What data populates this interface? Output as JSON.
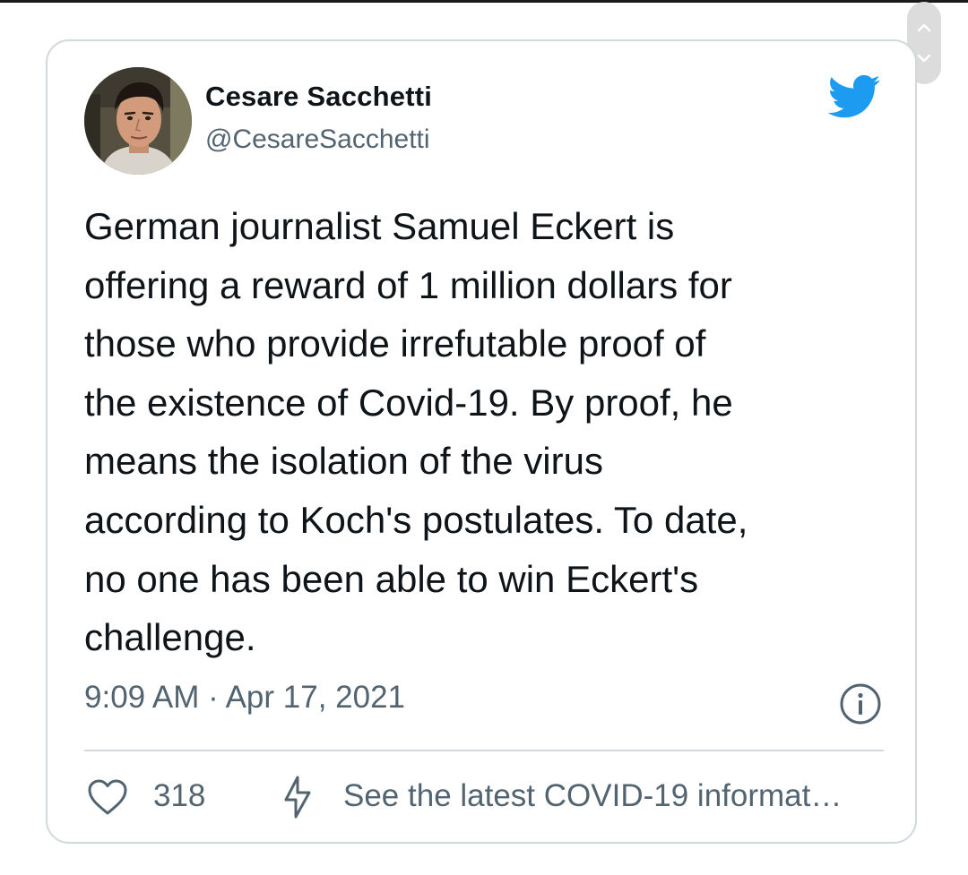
{
  "tweet": {
    "display_name": "Cesare Sacchetti",
    "handle": "@CesareSacchetti",
    "text_lines": [
      "German journalist Samuel Eckert is",
      "offering a reward of 1 million dollars for",
      "those who provide irrefutable proof of",
      "the existence of Covid-19. By proof, he",
      "means the isolation of the virus",
      "according to Koch's postulates. To date,",
      "no one has been able to win Eckert's",
      "challenge."
    ],
    "timestamp": "9:09 AM · Apr 17, 2021",
    "like_count": "318",
    "covid_link_text": "See the latest COVID-19 informat…"
  },
  "icons": {
    "brand": "twitter-bird-icon",
    "info": "info-icon",
    "like": "heart-icon",
    "covid": "lightning-bolt-icon",
    "scroll_up": "chevron-up-icon",
    "scroll_down": "chevron-down-icon"
  },
  "colors": {
    "twitter_blue": "#1d9bf0",
    "text_primary": "#0f1419",
    "text_secondary": "#536471",
    "border": "#cfd9de"
  }
}
